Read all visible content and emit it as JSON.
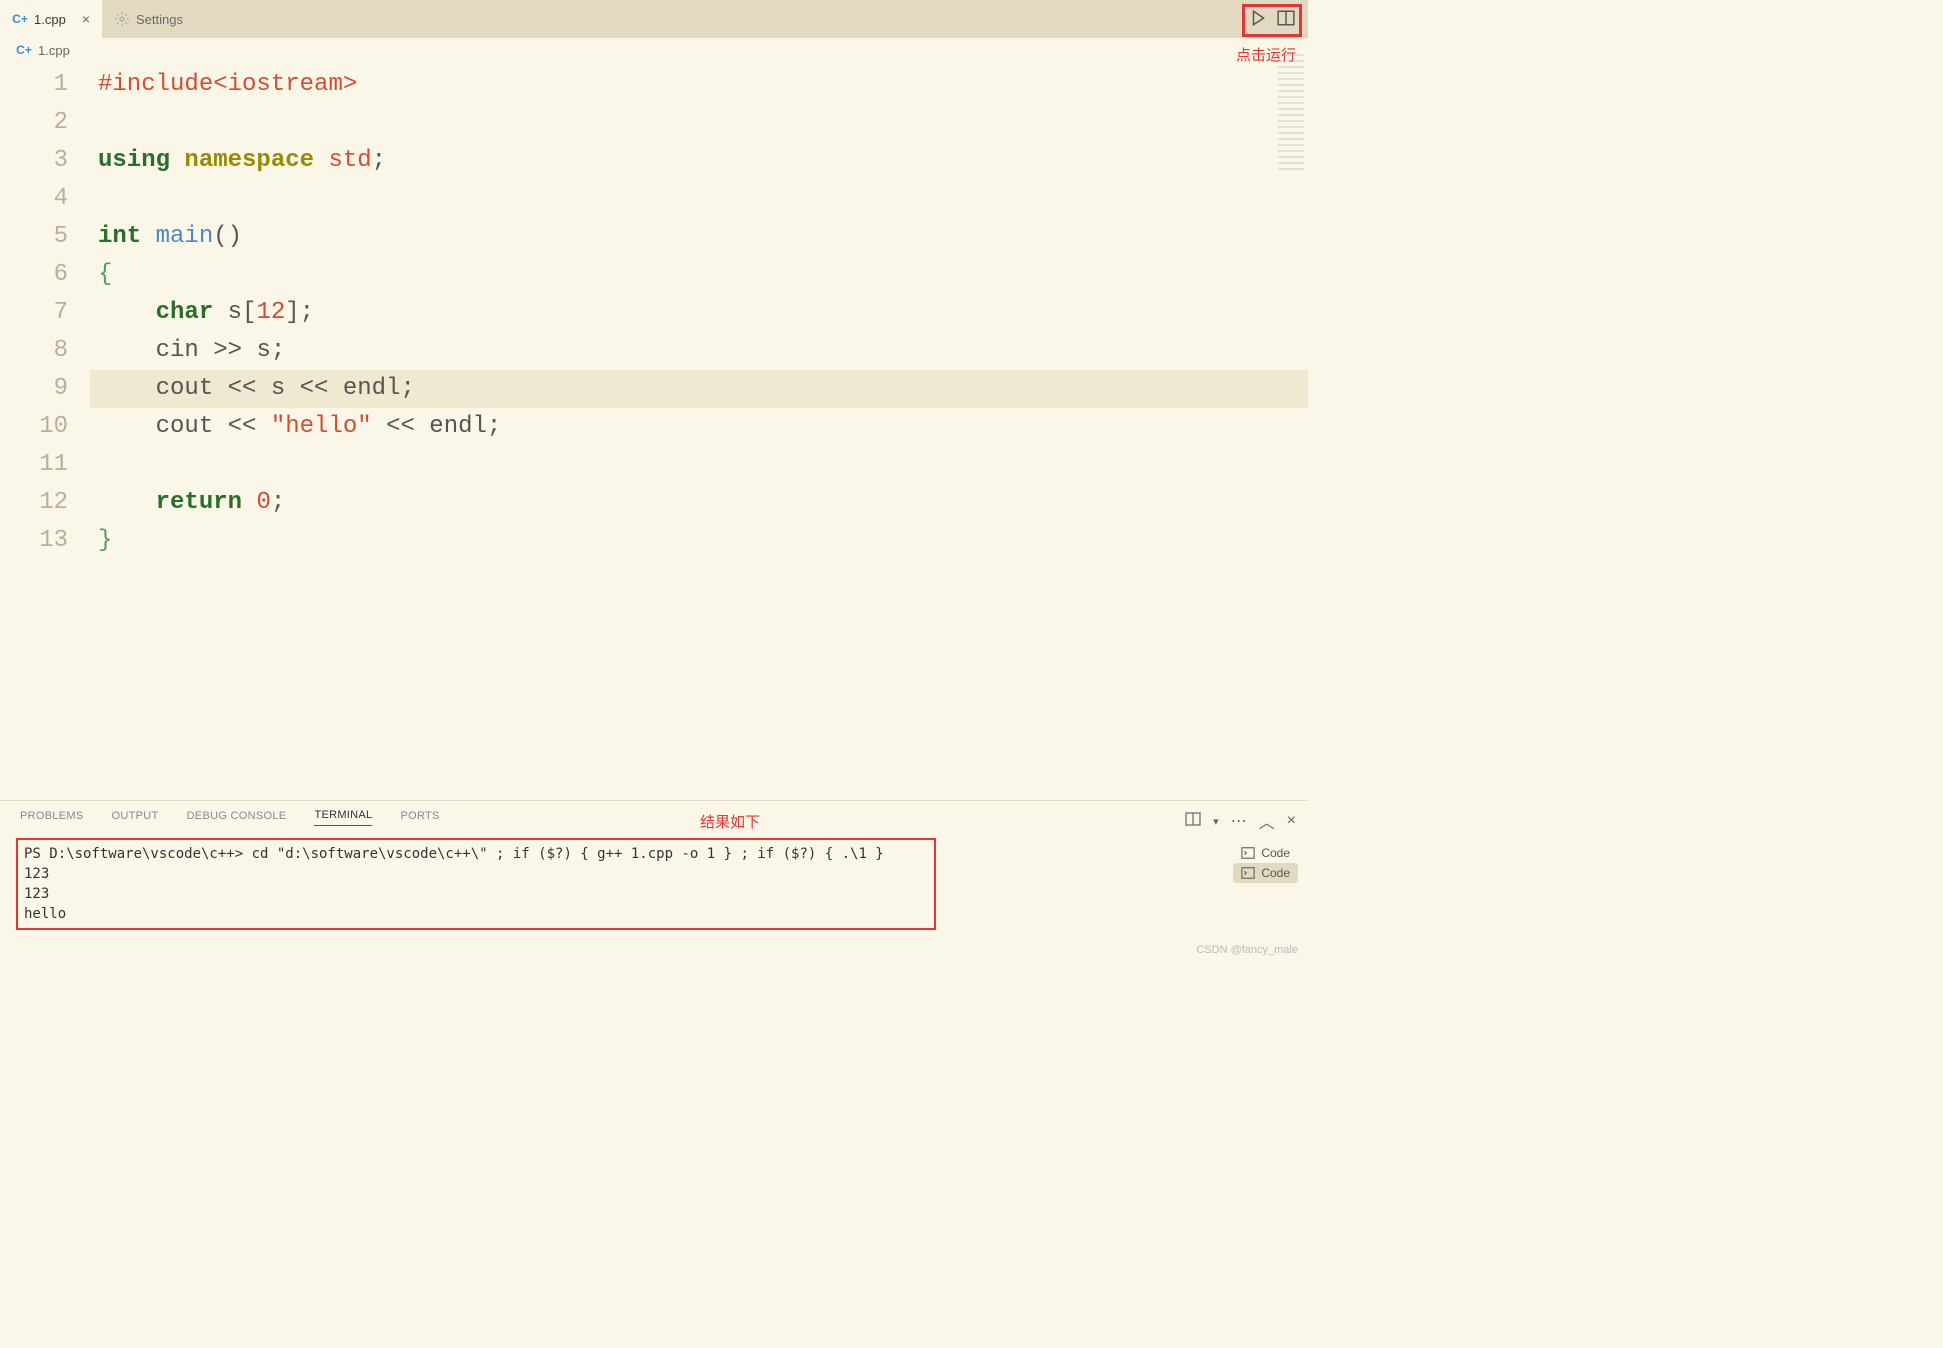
{
  "tabs": [
    {
      "label": "1.cpp",
      "icon": "cpp-icon",
      "active": true,
      "closable": true
    },
    {
      "label": "Settings",
      "icon": "settings-icon",
      "active": false,
      "closable": false
    }
  ],
  "breadcrumb": {
    "icon": "cpp-icon",
    "file": "1.cpp"
  },
  "annotations": {
    "run_label": "点击运行",
    "result_label": "结果如下"
  },
  "code": {
    "lines": [
      {
        "n": 1,
        "tokens": [
          [
            "tk-pp",
            "#include"
          ],
          [
            "tk-pp",
            "<iostream>"
          ]
        ]
      },
      {
        "n": 2,
        "tokens": []
      },
      {
        "n": 3,
        "tokens": [
          [
            "tk-kw",
            "using"
          ],
          [
            "",
            " "
          ],
          [
            "tk-kw-ns",
            "namespace"
          ],
          [
            "",
            " "
          ],
          [
            "tk-ns",
            "std"
          ],
          [
            "tk-op",
            ";"
          ]
        ]
      },
      {
        "n": 4,
        "tokens": []
      },
      {
        "n": 5,
        "tokens": [
          [
            "tk-type",
            "int"
          ],
          [
            "",
            " "
          ],
          [
            "tk-fn",
            "main"
          ],
          [
            "tk-op",
            "()"
          ]
        ]
      },
      {
        "n": 6,
        "tokens": [
          [
            "tk-brace",
            "{"
          ]
        ]
      },
      {
        "n": 7,
        "tokens": [
          [
            "",
            "    "
          ],
          [
            "tk-type",
            "char"
          ],
          [
            "",
            " "
          ],
          [
            "tk-id",
            "s"
          ],
          [
            "tk-op",
            "["
          ],
          [
            "tk-num",
            "12"
          ],
          [
            "tk-op",
            "];"
          ]
        ]
      },
      {
        "n": 8,
        "tokens": [
          [
            "",
            "    "
          ],
          [
            "tk-id",
            "cin"
          ],
          [
            "",
            " "
          ],
          [
            "tk-op",
            ">>"
          ],
          [
            "",
            " "
          ],
          [
            "tk-id",
            "s"
          ],
          [
            "tk-op",
            ";"
          ]
        ]
      },
      {
        "n": 9,
        "hl": true,
        "tokens": [
          [
            "",
            "    "
          ],
          [
            "tk-id",
            "cout"
          ],
          [
            "",
            " "
          ],
          [
            "tk-op",
            "<<"
          ],
          [
            "",
            " "
          ],
          [
            "tk-id",
            "s"
          ],
          [
            "",
            " "
          ],
          [
            "tk-op",
            "<<"
          ],
          [
            "",
            " "
          ],
          [
            "tk-id",
            "endl"
          ],
          [
            "tk-op",
            ";"
          ]
        ]
      },
      {
        "n": 10,
        "tokens": [
          [
            "",
            "    "
          ],
          [
            "tk-id",
            "cout"
          ],
          [
            "",
            " "
          ],
          [
            "tk-op",
            "<<"
          ],
          [
            "",
            " "
          ],
          [
            "tk-str",
            "\"hello\""
          ],
          [
            "",
            " "
          ],
          [
            "tk-op",
            "<<"
          ],
          [
            "",
            " "
          ],
          [
            "tk-id",
            "endl"
          ],
          [
            "tk-op",
            ";"
          ]
        ]
      },
      {
        "n": 11,
        "tokens": []
      },
      {
        "n": 12,
        "tokens": [
          [
            "",
            "    "
          ],
          [
            "tk-kw",
            "return"
          ],
          [
            "",
            " "
          ],
          [
            "tk-num",
            "0"
          ],
          [
            "tk-op",
            ";"
          ]
        ]
      },
      {
        "n": 13,
        "tokens": [
          [
            "tk-brace",
            "}"
          ]
        ]
      }
    ]
  },
  "panel": {
    "tabs": [
      "PROBLEMS",
      "OUTPUT",
      "DEBUG CONSOLE",
      "TERMINAL",
      "PORTS"
    ],
    "active": "TERMINAL",
    "code_items": [
      {
        "label": "Code",
        "sel": false
      },
      {
        "label": "Code",
        "sel": true
      }
    ],
    "terminal_lines": [
      "PS D:\\software\\vscode\\c++> cd \"d:\\software\\vscode\\c++\\\" ; if ($?) { g++ 1.cpp -o 1 } ; if ($?) { .\\1 }",
      "123",
      "123",
      "hello"
    ]
  },
  "watermark": "CSDN @fancy_male"
}
